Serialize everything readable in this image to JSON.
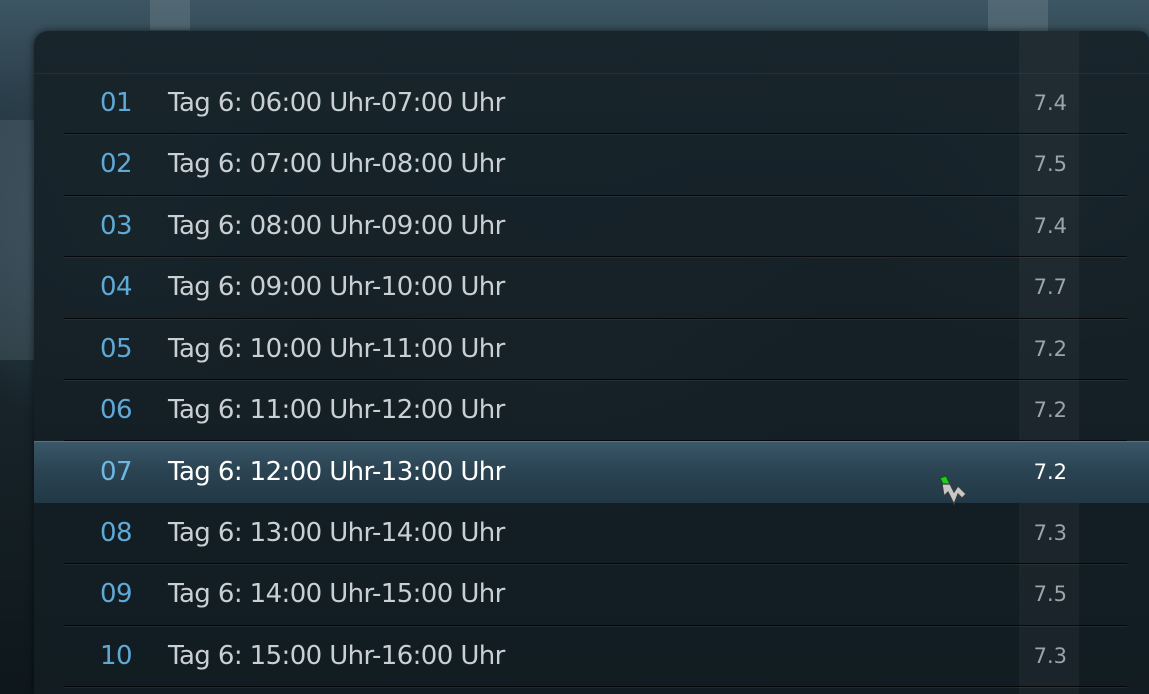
{
  "episodes": [
    {
      "number": "01",
      "title": "Tag 6: 06:00 Uhr-07:00 Uhr",
      "rating": "7.4"
    },
    {
      "number": "02",
      "title": "Tag 6: 07:00 Uhr-08:00 Uhr",
      "rating": "7.5"
    },
    {
      "number": "03",
      "title": "Tag 6: 08:00 Uhr-09:00 Uhr",
      "rating": "7.4"
    },
    {
      "number": "04",
      "title": "Tag 6: 09:00 Uhr-10:00 Uhr",
      "rating": "7.7"
    },
    {
      "number": "05",
      "title": "Tag 6: 10:00 Uhr-11:00 Uhr",
      "rating": "7.2"
    },
    {
      "number": "06",
      "title": "Tag 6: 11:00 Uhr-12:00 Uhr",
      "rating": "7.2"
    },
    {
      "number": "07",
      "title": "Tag 6: 12:00 Uhr-13:00 Uhr",
      "rating": "7.2"
    },
    {
      "number": "08",
      "title": "Tag 6: 13:00 Uhr-14:00 Uhr",
      "rating": "7.3"
    },
    {
      "number": "09",
      "title": "Tag 6: 14:00 Uhr-15:00 Uhr",
      "rating": "7.5"
    },
    {
      "number": "10",
      "title": "Tag 6: 15:00 Uhr-16:00 Uhr",
      "rating": "7.3"
    }
  ],
  "selected_index": 6,
  "colors": {
    "episode_number": "#5ea9d6",
    "title_text": "#c9cfd2",
    "selected_highlight": "#2b4453"
  },
  "icons": {
    "cursor": "mouse-pointer-icon"
  }
}
